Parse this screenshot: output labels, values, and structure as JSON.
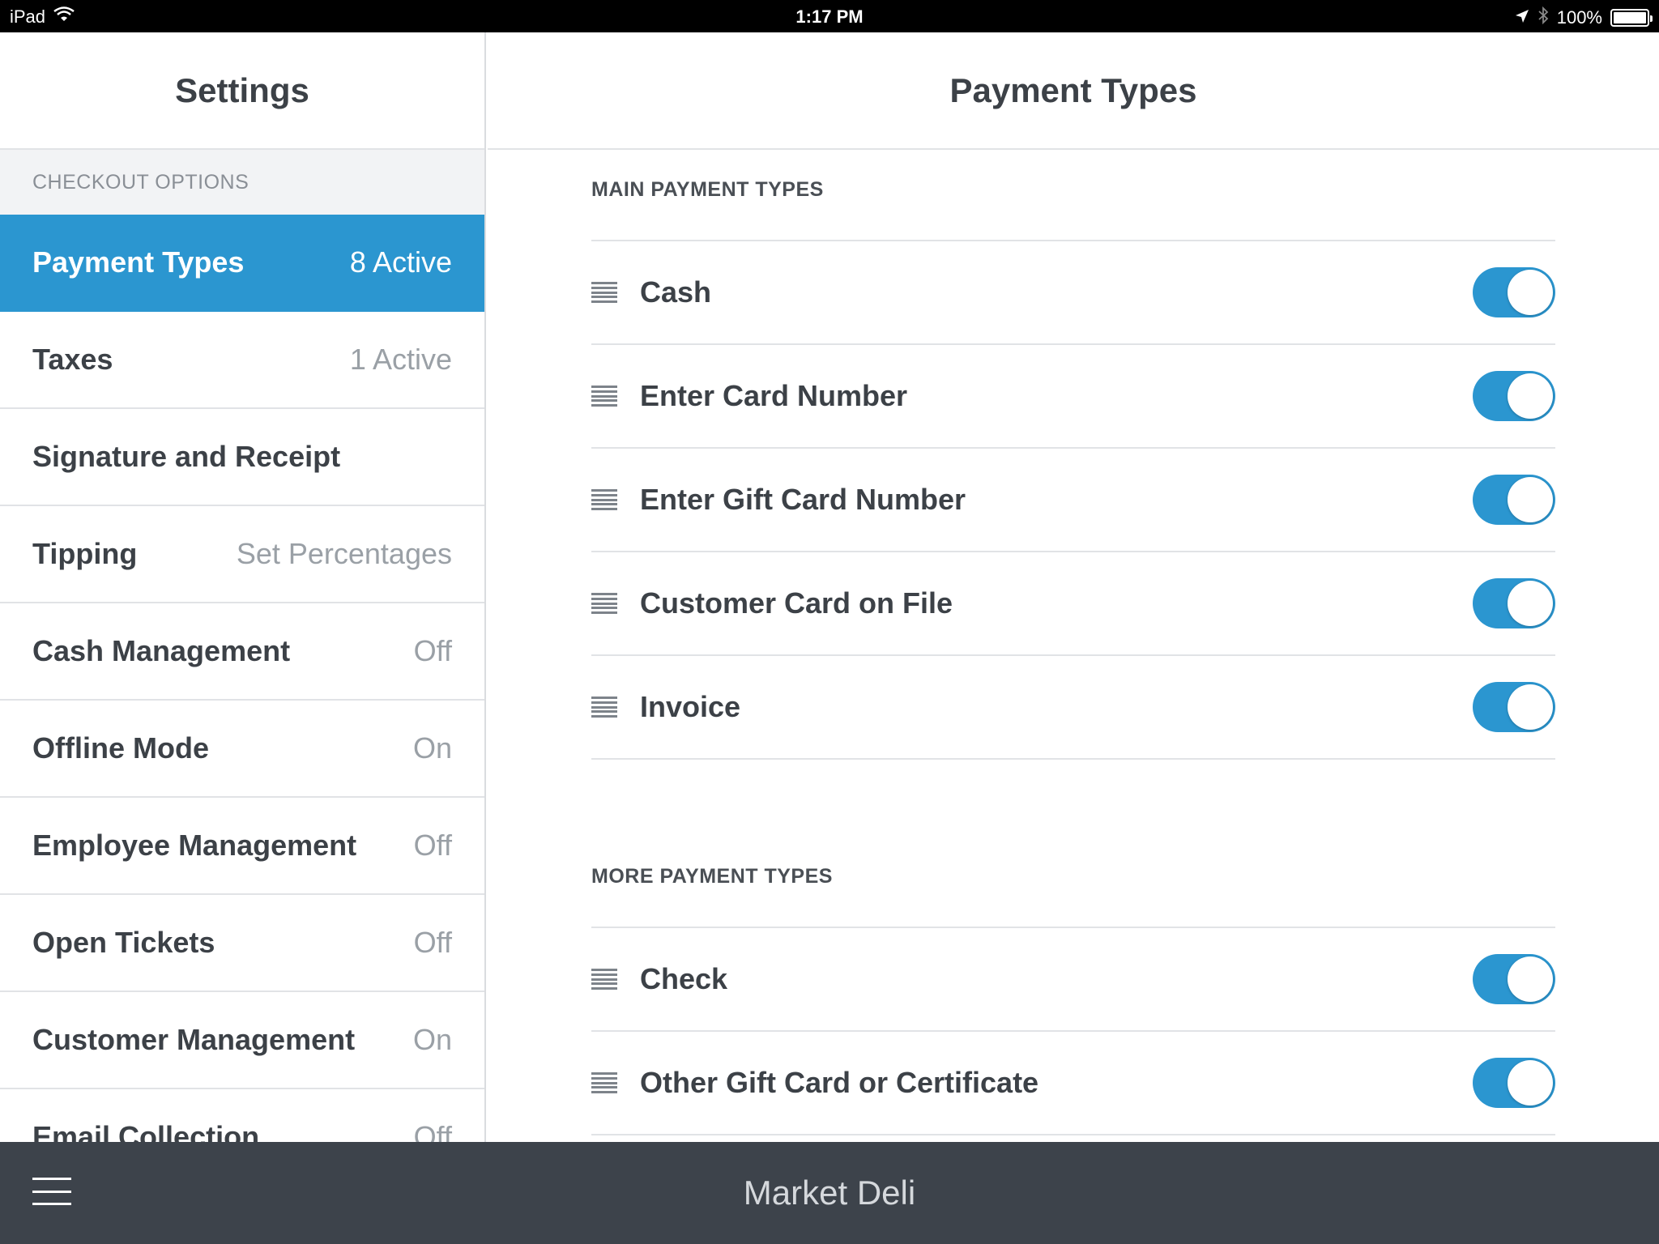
{
  "status_bar": {
    "device": "iPad",
    "time": "1:17 PM",
    "battery": "100%",
    "icons": [
      "wifi-icon",
      "location-icon",
      "bluetooth-icon",
      "battery-icon"
    ]
  },
  "sidebar": {
    "title": "Settings",
    "section": "CHECKOUT OPTIONS",
    "items": [
      {
        "label": "Payment Types",
        "value": "8 Active",
        "active": true
      },
      {
        "label": "Taxes",
        "value": "1 Active"
      },
      {
        "label": "Signature and Receipt",
        "value": ""
      },
      {
        "label": "Tipping",
        "value": "Set Percentages"
      },
      {
        "label": "Cash Management",
        "value": "Off"
      },
      {
        "label": "Offline Mode",
        "value": "On"
      },
      {
        "label": "Employee Management",
        "value": "Off"
      },
      {
        "label": "Open Tickets",
        "value": "Off"
      },
      {
        "label": "Customer Management",
        "value": "On"
      },
      {
        "label": "Email Collection",
        "value": "Off"
      }
    ]
  },
  "main": {
    "title": "Payment Types",
    "main_group": {
      "title": "MAIN PAYMENT TYPES",
      "items": [
        {
          "label": "Cash",
          "enabled": true
        },
        {
          "label": "Enter Card Number",
          "enabled": true
        },
        {
          "label": "Enter Gift Card Number",
          "enabled": true
        },
        {
          "label": "Customer Card on File",
          "enabled": true
        },
        {
          "label": "Invoice",
          "enabled": true
        }
      ]
    },
    "more_group": {
      "title": "MORE PAYMENT TYPES",
      "items": [
        {
          "label": "Check",
          "enabled": true
        },
        {
          "label": "Other Gift Card or Certificate",
          "enabled": true
        }
      ]
    }
  },
  "bottom_bar": {
    "store_name": "Market Deli"
  },
  "colors": {
    "accent": "#2b96d0",
    "bottom_bar": "#3d434b",
    "text": "#3c4147"
  }
}
